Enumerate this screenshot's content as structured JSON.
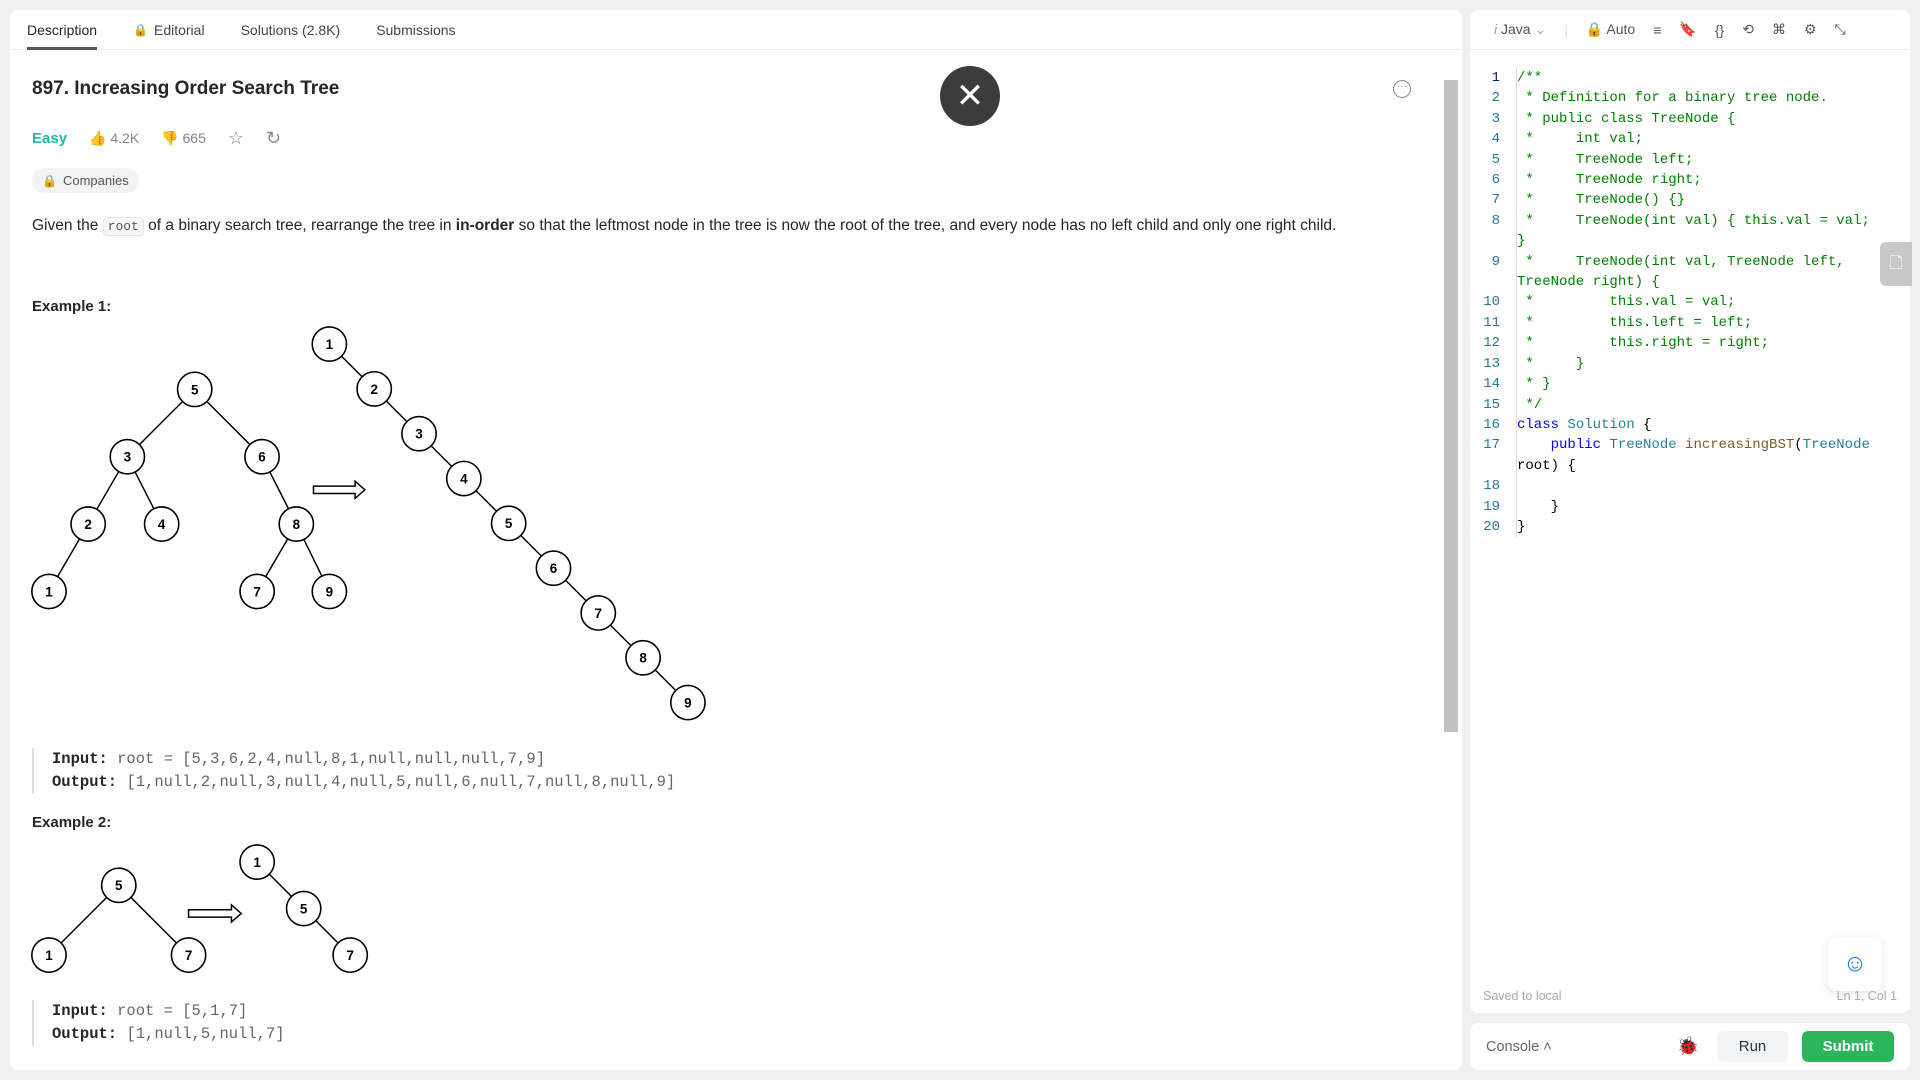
{
  "tabs": [
    "Description",
    "Editorial",
    "Solutions (2.8K)",
    "Submissions"
  ],
  "problem": {
    "title": "897. Increasing Order Search Tree",
    "difficulty": "Easy",
    "likes": "4.2K",
    "dislikes": "665",
    "companies": "Companies",
    "desc_1": "Given the ",
    "desc_code": "root",
    "desc_2": " of a binary search tree, rearrange the tree in ",
    "desc_bold": "in-order",
    "desc_3": " so that the leftmost node in the tree is now the root of the tree, and every node has no left child and only one right child."
  },
  "examples": [
    {
      "label": "Example 1:",
      "input_label": "Input:",
      "input": "root = [5,3,6,2,4,null,8,1,null,null,null,7,9]",
      "output_label": "Output:",
      "output": "[1,null,2,null,3,null,4,null,5,null,6,null,7,null,8,null,9]",
      "tree_before": [
        5,
        3,
        6,
        2,
        4,
        8,
        1,
        7,
        9
      ],
      "tree_after": [
        1,
        2,
        3,
        4,
        5,
        6,
        7,
        8,
        9
      ]
    },
    {
      "label": "Example 2:",
      "input_label": "Input:",
      "input": "root = [5,1,7]",
      "output_label": "Output:",
      "output": "[1,null,5,null,7]",
      "tree_before": [
        5,
        1,
        7
      ],
      "tree_after": [
        1,
        5,
        7
      ]
    }
  ],
  "editor": {
    "language": "Java",
    "mode": "Auto",
    "saved": "Saved to local",
    "position": "Ln 1, Col 1",
    "lines": [
      [
        [
          "c",
          "/**"
        ]
      ],
      [
        [
          "c",
          " * Definition for a binary tree node."
        ]
      ],
      [
        [
          "c",
          " * public class TreeNode {"
        ]
      ],
      [
        [
          "c",
          " *     int val;"
        ]
      ],
      [
        [
          "c",
          " *     TreeNode left;"
        ]
      ],
      [
        [
          "c",
          " *     TreeNode right;"
        ]
      ],
      [
        [
          "c",
          " *     TreeNode() {}"
        ]
      ],
      [
        [
          "c",
          " *     TreeNode(int val) { this.val = val; }"
        ]
      ],
      [
        [
          "c",
          " *     TreeNode(int val, TreeNode left, TreeNode right) {"
        ]
      ],
      [
        [
          "c",
          " *         this.val = val;"
        ]
      ],
      [
        [
          "c",
          " *         this.left = left;"
        ]
      ],
      [
        [
          "c",
          " *         this.right = right;"
        ]
      ],
      [
        [
          "c",
          " *     }"
        ]
      ],
      [
        [
          "c",
          " * }"
        ]
      ],
      [
        [
          "c",
          " */"
        ]
      ],
      [
        [
          "kw",
          "class "
        ],
        [
          "ty",
          "Solution "
        ],
        [
          "pl",
          "{"
        ]
      ],
      [
        [
          "pl",
          "    "
        ],
        [
          "kw",
          "public "
        ],
        [
          "ty",
          "TreeNode "
        ],
        [
          "fn",
          "increasingBST"
        ],
        [
          "pl",
          "("
        ],
        [
          "ty",
          "TreeNode "
        ],
        [
          "pl",
          "root) {"
        ]
      ],
      [
        [
          "pl",
          " "
        ]
      ],
      [
        [
          "pl",
          "    }"
        ]
      ],
      [
        [
          "pl",
          "}"
        ]
      ]
    ]
  },
  "bottom": {
    "console": "Console",
    "run": "Run",
    "submit": "Submit"
  },
  "colors": {
    "easy": "#1cb8a8",
    "submit": "#2db55d",
    "lock": "#f0a020"
  }
}
